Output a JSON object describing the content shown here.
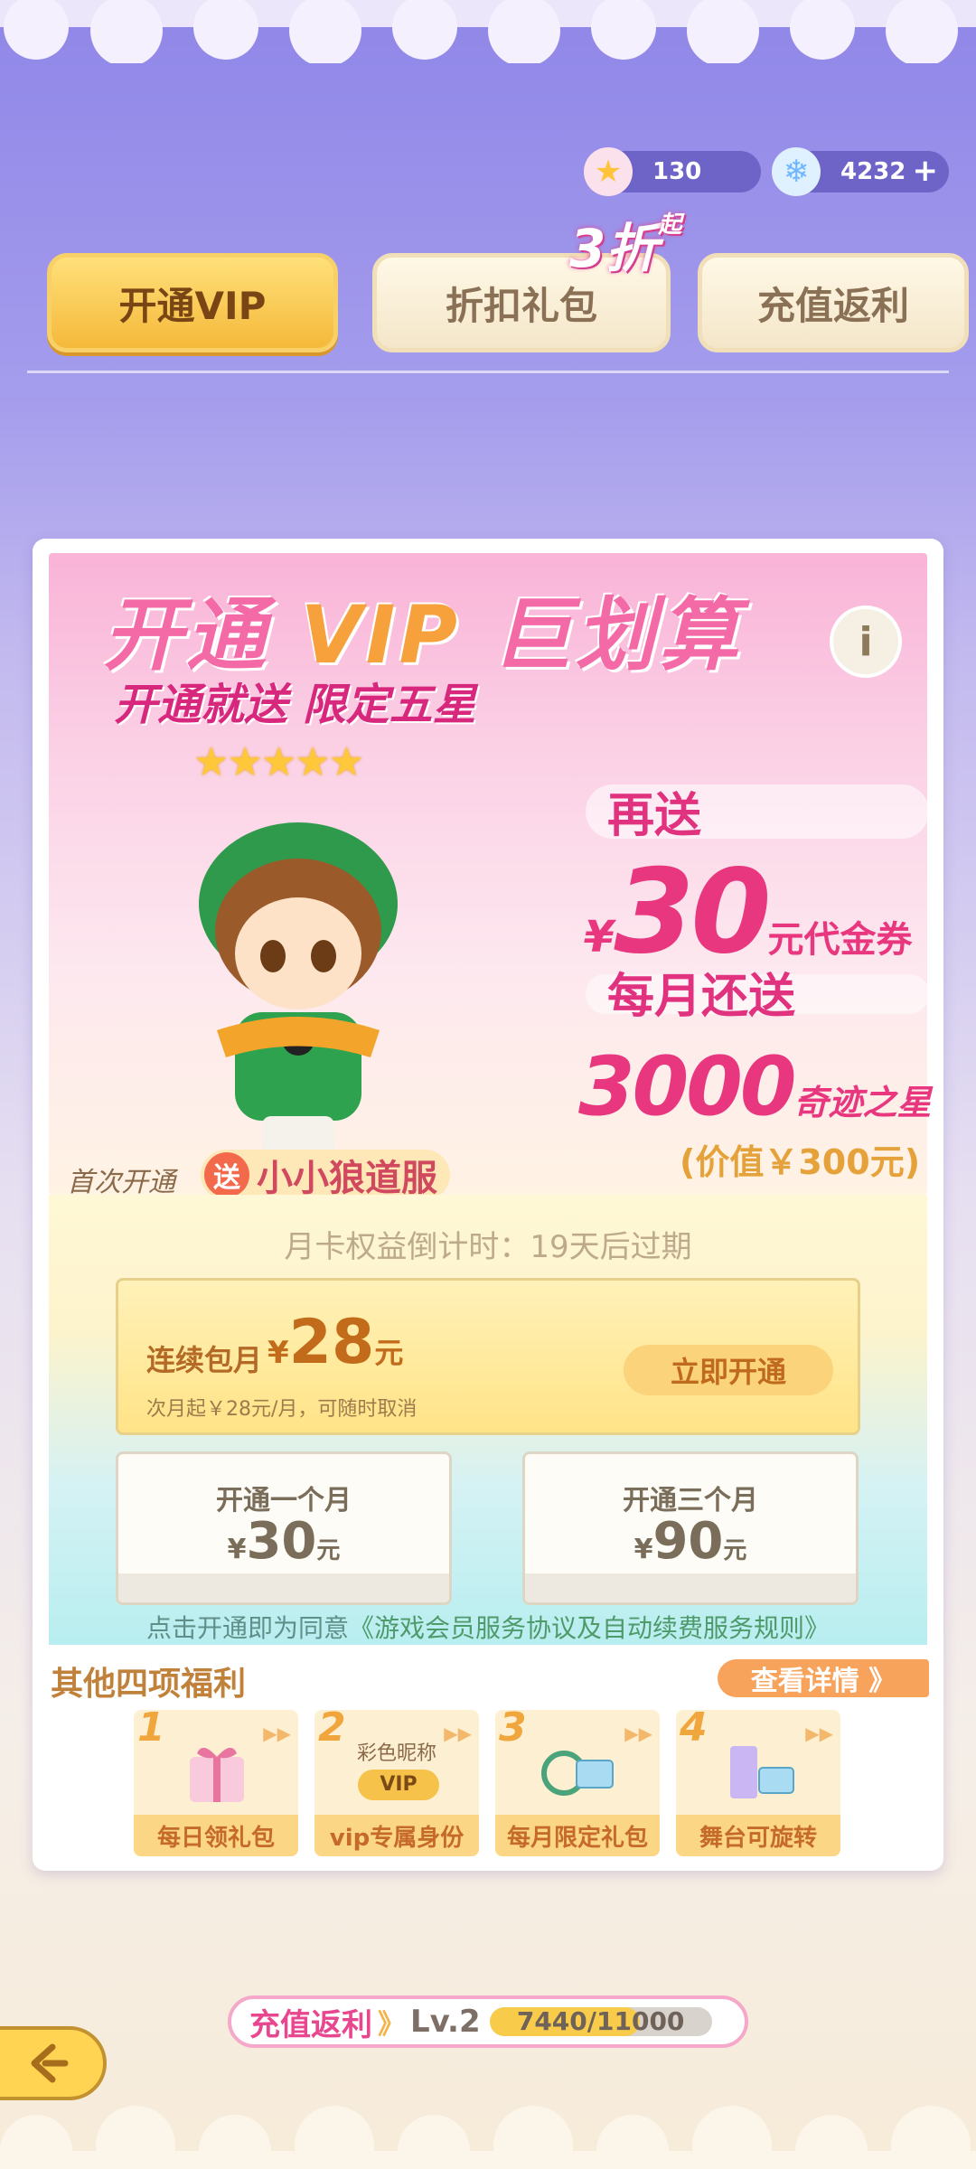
{
  "currency": {
    "stars": "130",
    "diamonds": "4232"
  },
  "tabs": [
    {
      "label": "开通VIP",
      "active": true
    },
    {
      "label": "折扣礼包",
      "active": false
    },
    {
      "label": "充值返利",
      "active": false
    }
  ],
  "discount_badge": {
    "value": "3折",
    "suffix": "起"
  },
  "banner": {
    "title_part1": "开通",
    "title_vip": "VIP",
    "title_part2": "巨划算",
    "subtitle": "开通就送 限定五星",
    "stars": "★★★★★",
    "again_label": "再送",
    "coupon_symbol": "¥",
    "coupon_amount": "30",
    "coupon_unit": "元代金券",
    "monthly_label": "每月还送",
    "stars_amount": "3000",
    "stars_unit": "奇迹之星",
    "worth": "(价值￥300元)",
    "first_open": "首次开通",
    "gift_send": "送",
    "gift_name": "小小狼道服"
  },
  "purchase": {
    "countdown": "月卡权益倒计时：19天后过期",
    "subscription_label": "连续包月",
    "subscription_symbol": "¥",
    "subscription_price": "28",
    "subscription_unit": "元",
    "subscription_note": "次月起￥28元/月，可随时取消",
    "open_button": "立即开通",
    "plans": [
      {
        "name": "开通一个月",
        "symbol": "¥",
        "price": "30",
        "unit": "元"
      },
      {
        "name": "开通三个月",
        "symbol": "¥",
        "price": "90",
        "unit": "元"
      }
    ],
    "agreement_prefix": "点击开通即为同意",
    "agreement_link": "《游戏会员服务协议及自动续费服务规则》"
  },
  "benefits": {
    "title": "其他四项福利",
    "details_button": "查看详情 》",
    "items": [
      {
        "num": "1",
        "label": "每日领礼包"
      },
      {
        "num": "2",
        "label": "vip专属身份",
        "caption": "彩色昵称",
        "badge": "VIP"
      },
      {
        "num": "3",
        "label": "每月限定礼包"
      },
      {
        "num": "4",
        "label": "舞台可旋转"
      }
    ]
  },
  "recharge": {
    "label": "充值返利",
    "chevron": "》",
    "level": "Lv.2",
    "progress_text": "7440/11000",
    "progress_fraction": 0.676
  },
  "colors": {
    "accent": "#f5b93a",
    "pink": "#e8377f",
    "background_top": "#8f86e8"
  }
}
